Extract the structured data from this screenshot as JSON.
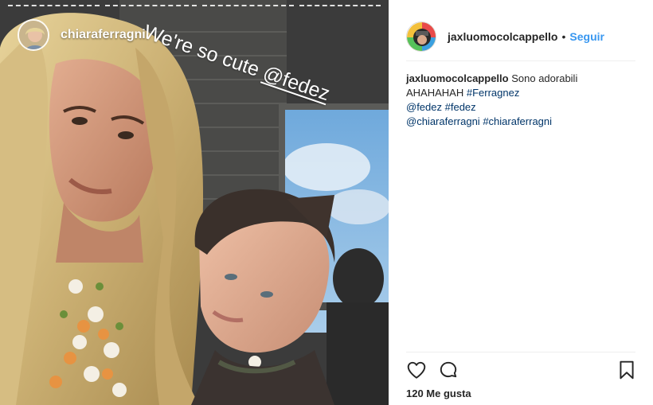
{
  "story": {
    "username": "chiaraferragni",
    "overlay_text": "We're so cute",
    "overlay_mention": "@fedez"
  },
  "post": {
    "username": "jaxluomocolcappello",
    "separator": "•",
    "follow_label": "Seguir",
    "caption": {
      "username": "jaxluomocolcappello",
      "line1_text": "Sono adorabili",
      "line2_text": "AHAHAHAH",
      "hashtag_ferragnez": "#Ferragnez",
      "mention_fedez": "@fedez",
      "hashtag_fedez": "#fedez",
      "mention_chiara": "@chiaraferragni",
      "hashtag_chiara": "#chiaraferragni"
    },
    "likes_label": "120 Me gusta"
  },
  "icons": {
    "like": "heart-icon",
    "comment": "comment-icon",
    "save": "bookmark-icon"
  },
  "colors": {
    "follow_blue": "#3897f0",
    "link_blue": "#003569",
    "divider": "#efefef"
  }
}
